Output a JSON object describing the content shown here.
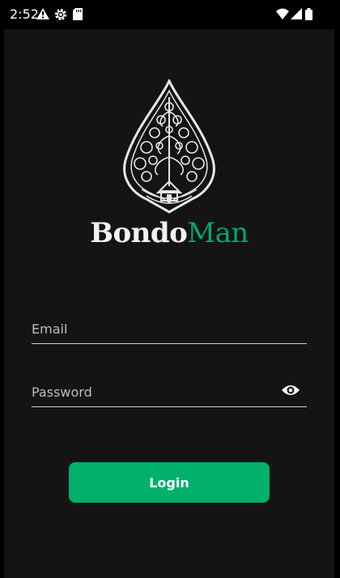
{
  "status_bar": {
    "time": "2:52",
    "left_icons": [
      "warning-icon",
      "settings-icon",
      "sd-card-icon"
    ],
    "right_icons": [
      "wifi-icon",
      "signal-icon",
      "battery-icon"
    ]
  },
  "brand": {
    "part1": "Bondo",
    "part2": "Man",
    "accent_color": "#00a86b"
  },
  "form": {
    "email_placeholder": "Email",
    "password_placeholder": "Password",
    "login_label": "Login"
  },
  "colors": {
    "background": "#141414",
    "button": "#00b06b"
  }
}
